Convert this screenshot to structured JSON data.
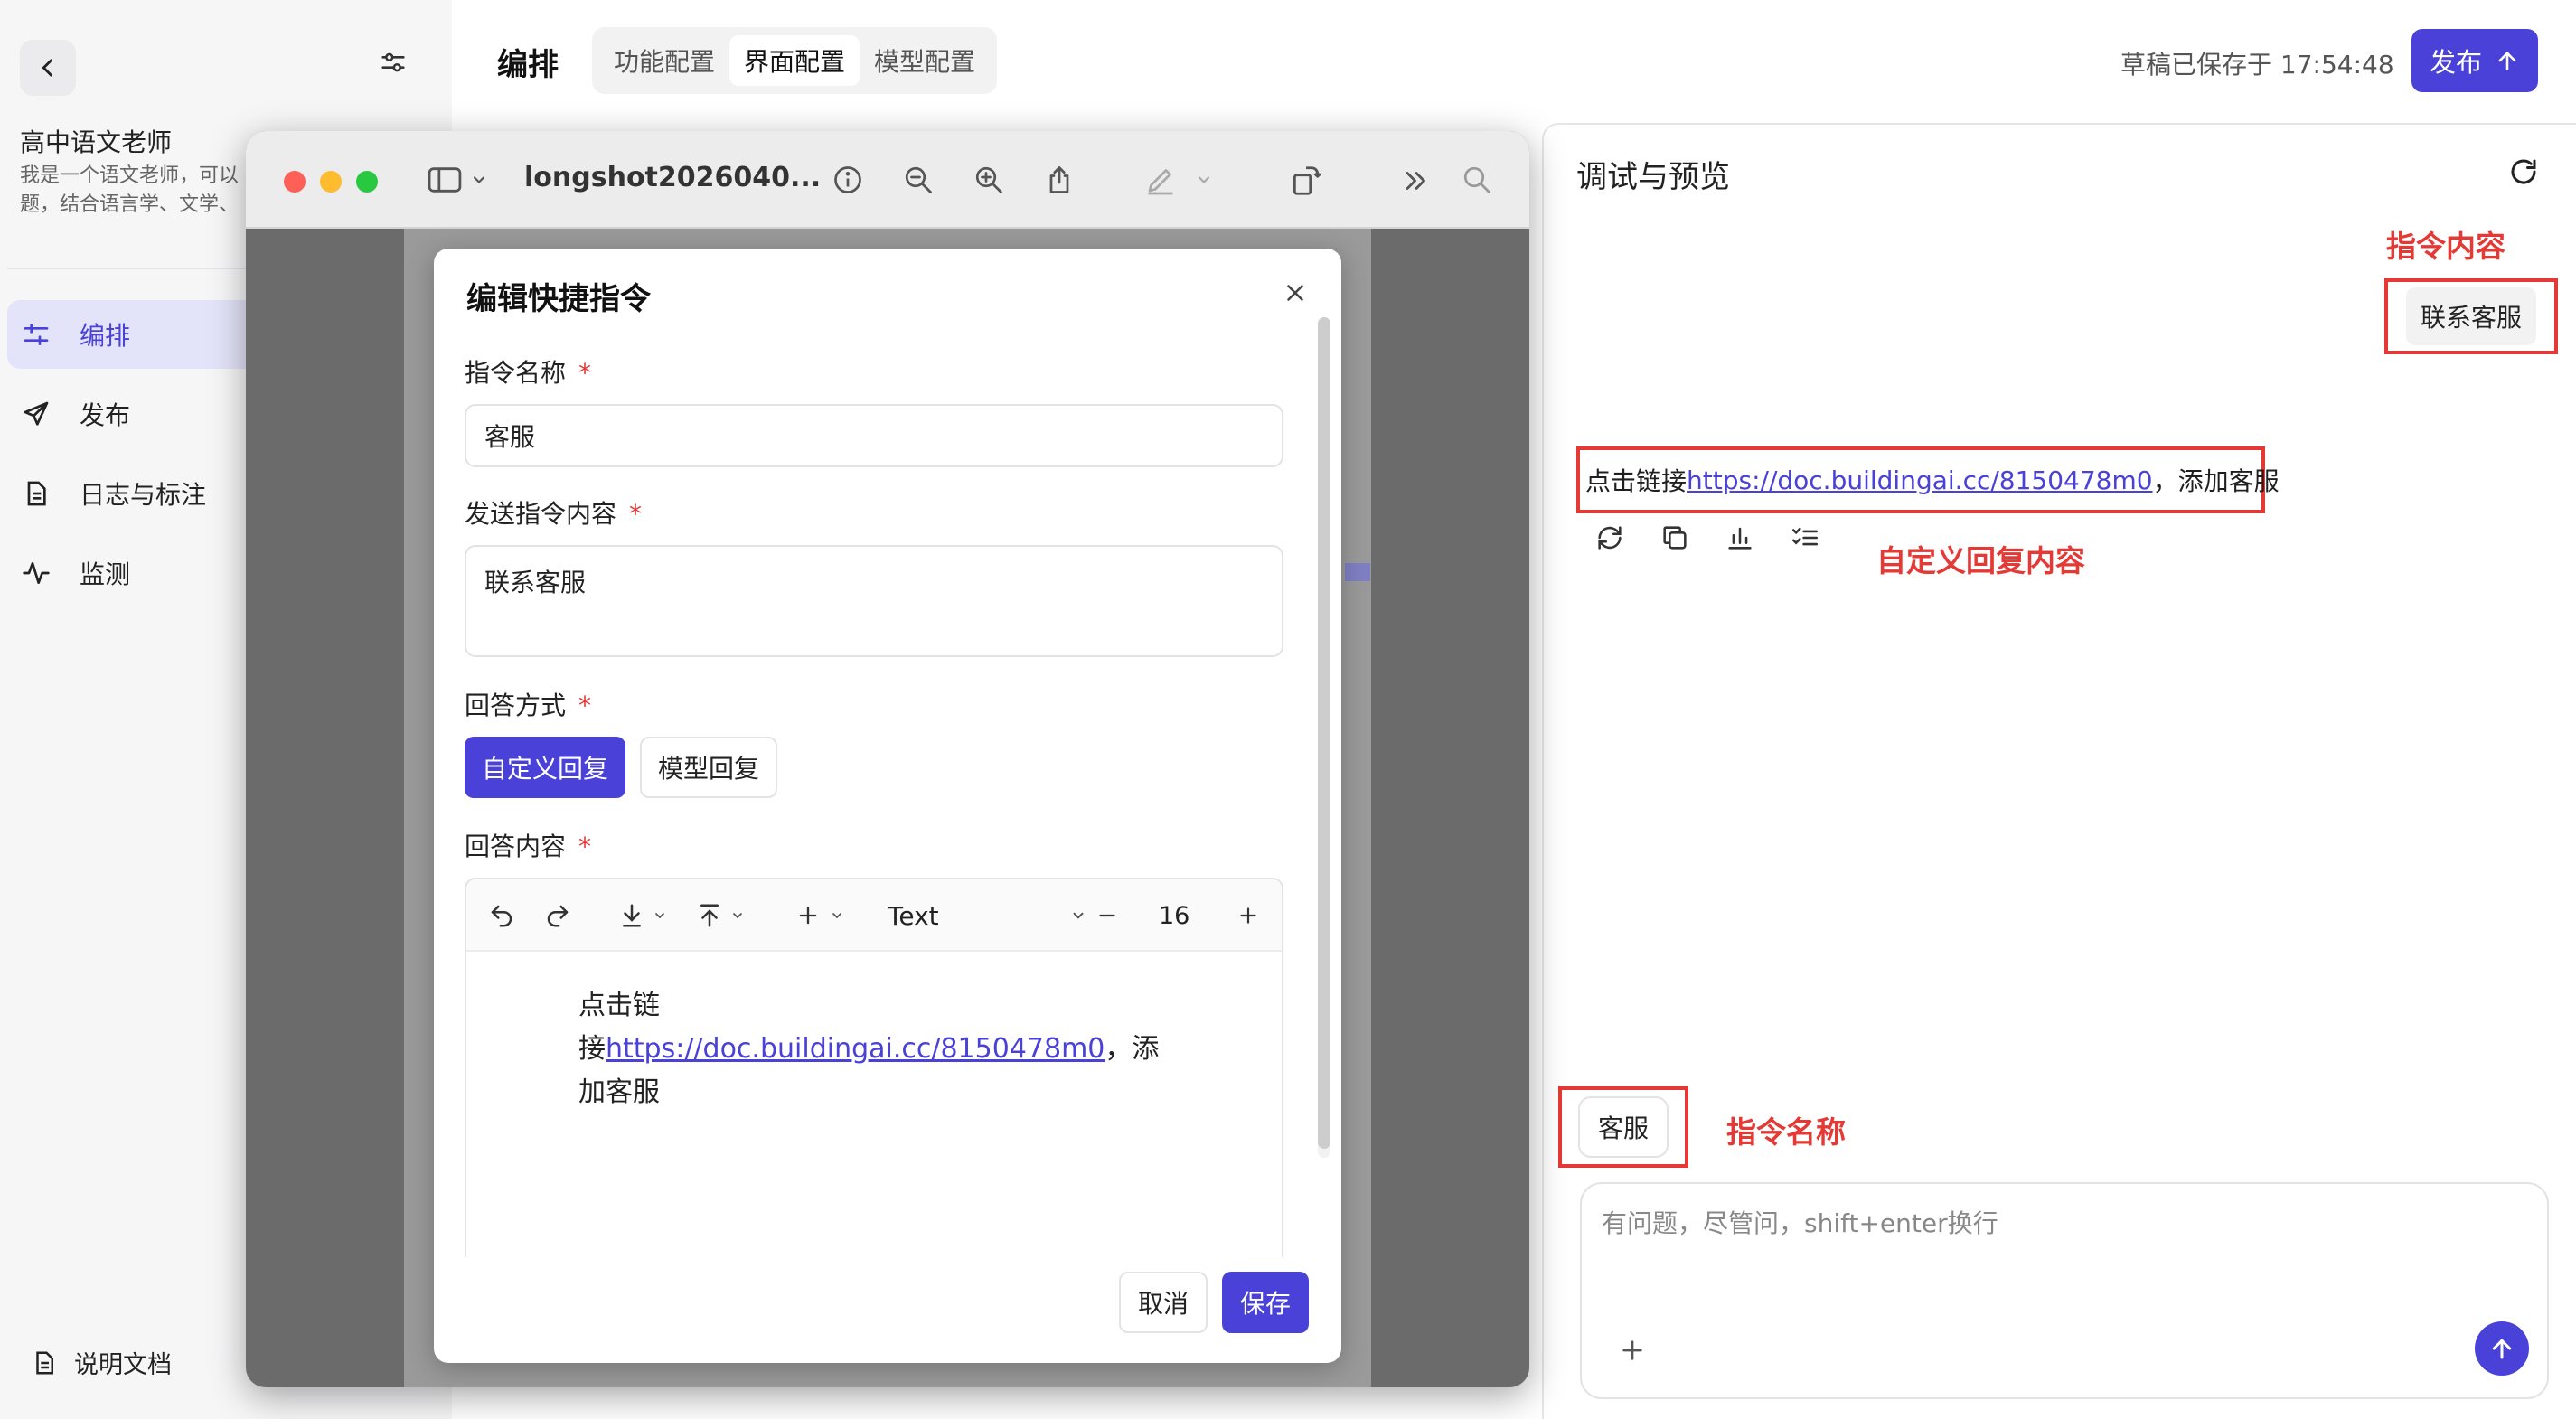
{
  "sidebar": {
    "agent_name": "高中语文老师",
    "agent_desc_line1": "我是一个语文老师，可以",
    "agent_desc_line2": "题，结合语言学、文学、",
    "nav": [
      {
        "label": "编排",
        "icon": "sliders-icon",
        "active": true
      },
      {
        "label": "发布",
        "icon": "send-icon"
      },
      {
        "label": "日志与标注",
        "icon": "document-icon"
      },
      {
        "label": "监测",
        "icon": "activity-icon"
      }
    ],
    "docs_label": "说明文档"
  },
  "header": {
    "title": "编排",
    "tabs": [
      {
        "label": "功能配置"
      },
      {
        "label": "界面配置",
        "active": true
      },
      {
        "label": "模型配置"
      }
    ],
    "save_status": "草稿已保存于 17:54:48",
    "publish_label": "发布"
  },
  "preview_window": {
    "filename": "longshot2026040..."
  },
  "modal": {
    "title": "编辑快捷指令",
    "name_label": "指令名称",
    "name_value": "客服",
    "content_label": "发送指令内容",
    "content_value": "联系客服",
    "answer_mode_label": "回答方式",
    "mode_custom": "自定义回复",
    "mode_model": "模型回复",
    "answer_content_label": "回答内容",
    "required_mark": "*",
    "editor": {
      "font_label": "Text",
      "font_size": "16",
      "text_line1": "点击链",
      "text_line2_prefix": "接",
      "link": "https://doc.buildingai.cc/8150478m0",
      "text_line2_suffix": "，添",
      "text_line3": "加客服"
    },
    "cancel_label": "取消",
    "save_label": "保存"
  },
  "preview": {
    "title": "调试与预览",
    "user_message": "联系客服",
    "reply_prefix": "点击链接",
    "reply_link": "https://doc.buildingai.cc/8150478m0",
    "reply_suffix": "，添加客服",
    "quick_command": "客服",
    "input_placeholder": "有问题，尽管问，shift+enter换行"
  },
  "annotations": {
    "command_content": "指令内容",
    "custom_reply": "自定义回复内容",
    "command_name": "指令名称"
  },
  "colors": {
    "accent": "#4a41d8",
    "annotation_red": "#e53935"
  }
}
